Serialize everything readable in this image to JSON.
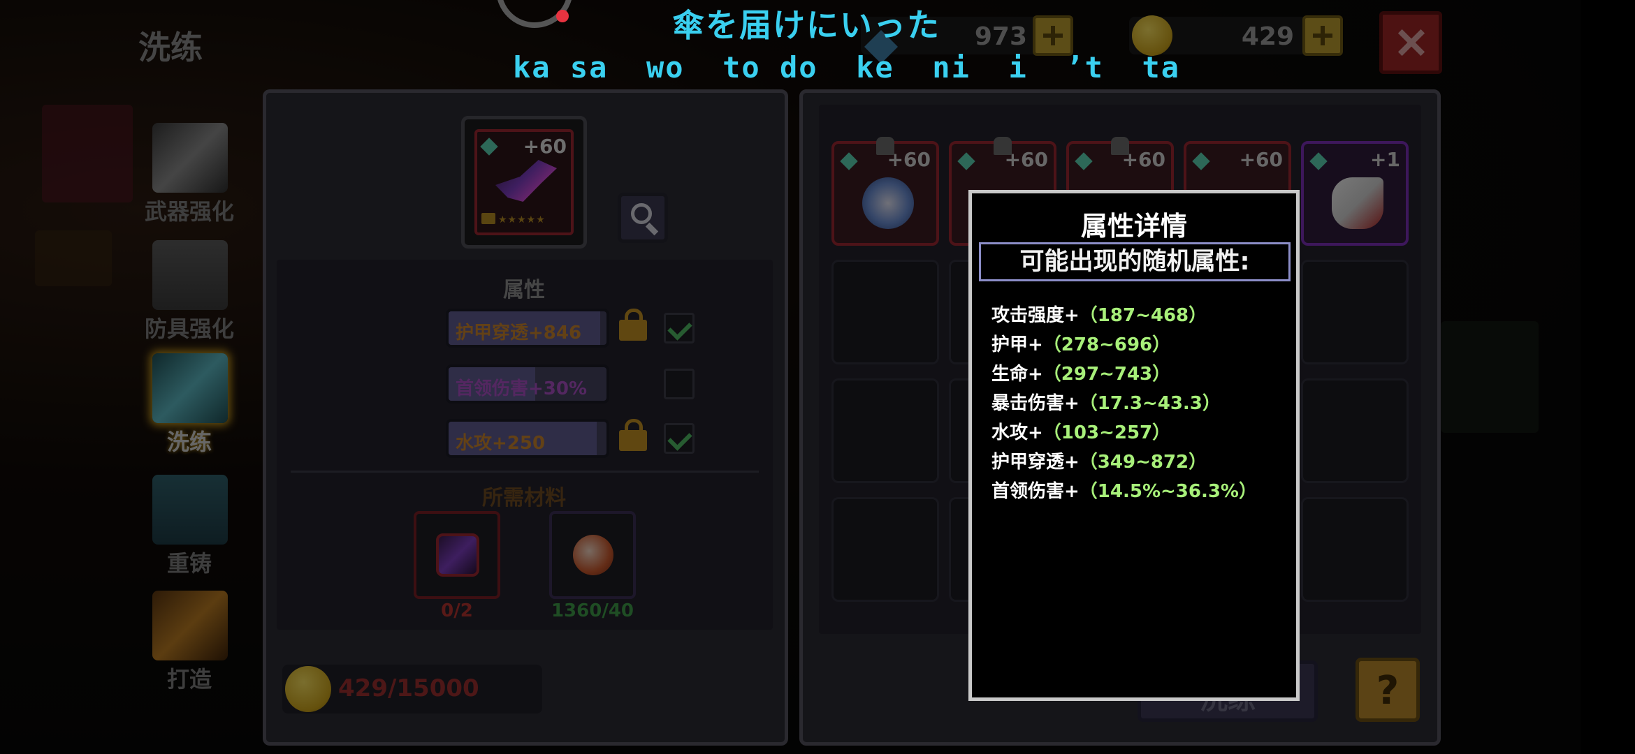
{
  "page": {
    "title": "洗练"
  },
  "lyrics": {
    "japanese": "傘を届けにいった",
    "romaji": "ka sa  wo  to do  ke  ni  i  ’t  ta"
  },
  "currency": {
    "gems": "973",
    "coins": "429"
  },
  "nav": [
    {
      "label": "武器强化",
      "icon": "sword-icon"
    },
    {
      "label": "防具强化",
      "icon": "armor-icon"
    },
    {
      "label": "洗练",
      "icon": "refine-sword-icon",
      "active": true
    },
    {
      "label": "重铸",
      "icon": "armor-recast-icon"
    },
    {
      "label": "打造",
      "icon": "craft-icon"
    }
  ],
  "left_panel": {
    "item_level": "+60",
    "attributes_title": "属性",
    "attributes": [
      {
        "text": "护甲穿透+846",
        "color": "#c7832c",
        "fill": 0.96,
        "locked": true,
        "checked": true
      },
      {
        "text": "首领伤害+30%",
        "color": "#a84fc2",
        "fill": 0.55,
        "locked": false,
        "checked": false
      },
      {
        "text": "水攻+250",
        "color": "#c7832c",
        "fill": 0.94,
        "locked": true,
        "checked": true
      }
    ],
    "materials_title": "所需材料",
    "materials": [
      {
        "count": "0/2",
        "color": "#b3332f",
        "icon": "weapon-material-icon"
      },
      {
        "count": "1360/40",
        "color": "#3f9a48",
        "icon": "refine-stone-icon"
      }
    ],
    "cost": "429/15000"
  },
  "right_panel": {
    "equipment": [
      {
        "level": "+60",
        "icon": "shield-item-icon",
        "color": "#9a2630"
      },
      {
        "level": "+60",
        "icon": "weapon-item-icon",
        "color": "#9a2630"
      },
      {
        "level": "+60",
        "icon": "weapon-item-icon",
        "color": "#9a2630"
      },
      {
        "level": "+60",
        "icon": "weapon-item-icon",
        "color": "#9a2630"
      },
      {
        "level": "+1",
        "icon": "horn-item-icon",
        "color": "#7b2fb6"
      }
    ],
    "confirm_label": "洗练",
    "help_label": "?"
  },
  "popup": {
    "title": "属性详情",
    "subtitle": "可能出现的随机属性:",
    "properties": [
      {
        "name": "攻击强度+",
        "range": "（187~468）"
      },
      {
        "name": "护甲+",
        "range": "（278~696）"
      },
      {
        "name": "生命+",
        "range": "（297~743）"
      },
      {
        "name": "暴击伤害+",
        "range": "（17.3~43.3）"
      },
      {
        "name": "水攻+",
        "range": "（103~257）"
      },
      {
        "name": "护甲穿透+",
        "range": "（349~872）"
      },
      {
        "name": "首领伤害+",
        "range": "（14.5%~36.3%）"
      }
    ]
  }
}
